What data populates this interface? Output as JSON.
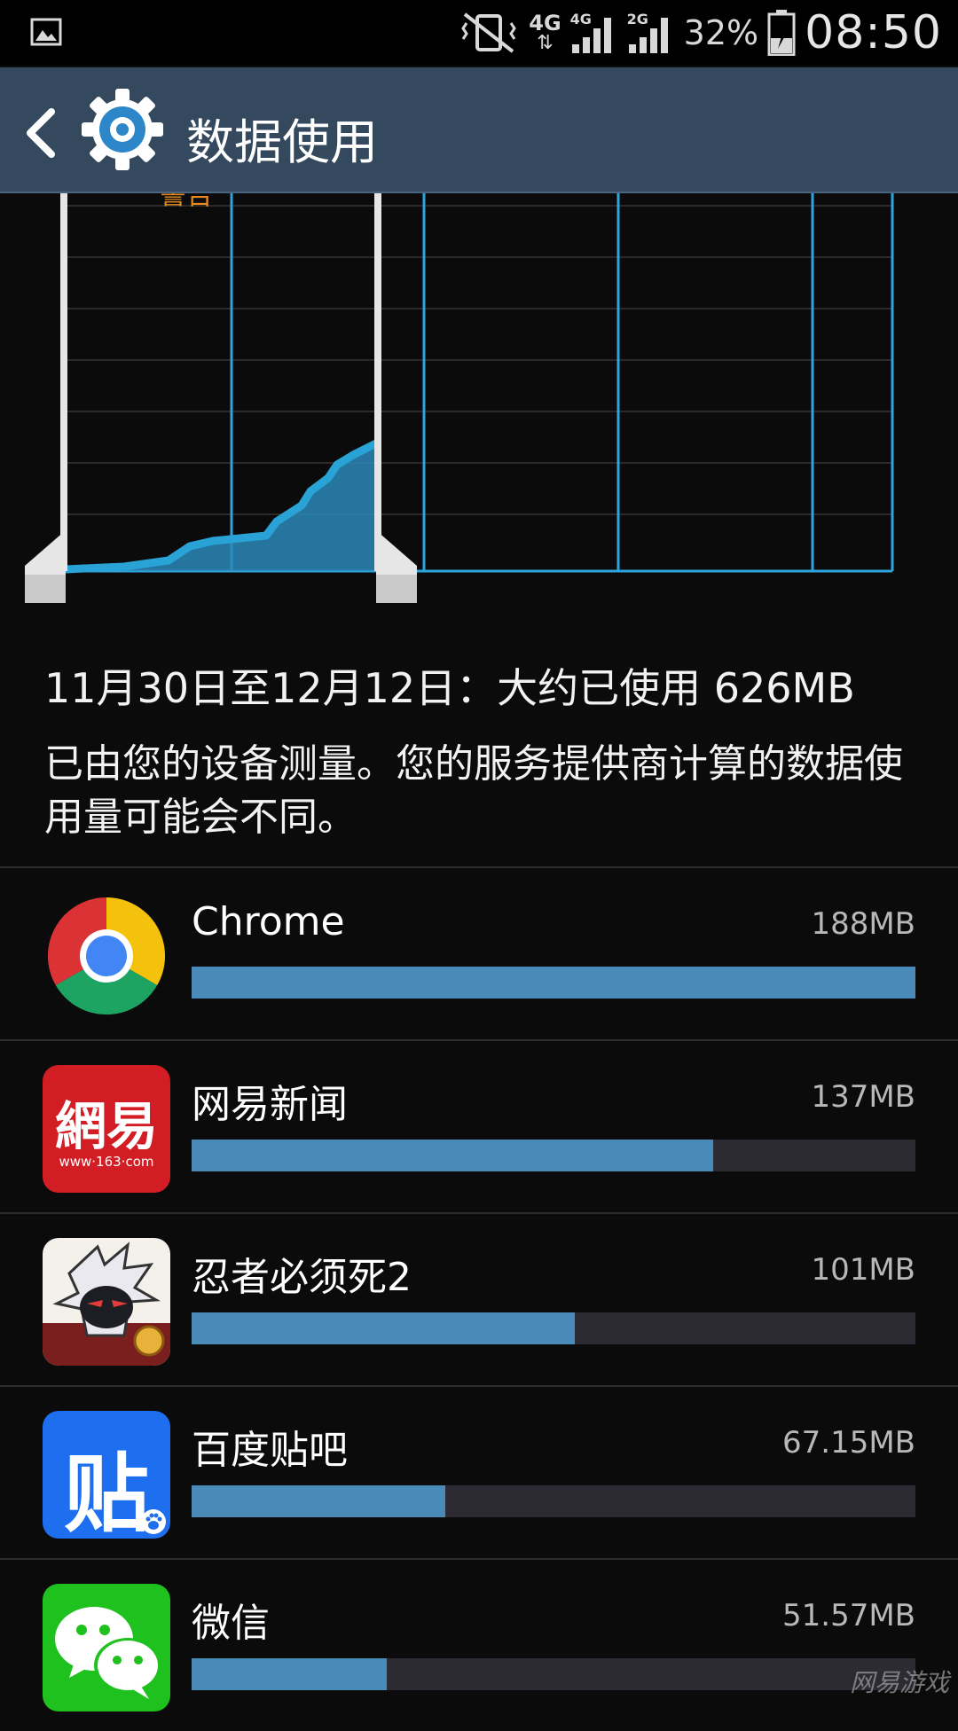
{
  "status_bar": {
    "network_primary": "4G",
    "signal_1_label": "4G",
    "signal_2_label": "2G",
    "battery_percent": "32%",
    "time": "08:50"
  },
  "action_bar": {
    "title": "数据使用",
    "icons": [
      "back-icon",
      "gear-icon"
    ]
  },
  "chart": {
    "warning_label": "警告",
    "colors": {
      "usage": "#29a3d6",
      "grid": "#2a2a2a",
      "handle": "#e6e6e6",
      "warning": "#e58a1f"
    }
  },
  "summary": {
    "range_text": "11月30日至12月12日：大约已使用 626MB",
    "note": "已由您的设备测量。您的服务提供商计算的数据使用量可能会不同。"
  },
  "apps": [
    {
      "name": "Chrome",
      "size": "188MB",
      "fraction": 1.0,
      "icon": "chrome-icon"
    },
    {
      "name": "网易新闻",
      "size": "137MB",
      "fraction": 0.72,
      "icon": "netease-news-icon",
      "icon_text": "網易",
      "icon_sub": "www·163·com"
    },
    {
      "name": "忍者必须死2",
      "size": "101MB",
      "fraction": 0.53,
      "icon": "ninja-game-icon"
    },
    {
      "name": "百度贴吧",
      "size": "67.15MB",
      "fraction": 0.35,
      "icon": "baidu-tieba-icon",
      "icon_text": "贴"
    },
    {
      "name": "微信",
      "size": "51.57MB",
      "fraction": 0.27,
      "icon": "wechat-icon"
    }
  ],
  "watermark": "网易游戏"
}
